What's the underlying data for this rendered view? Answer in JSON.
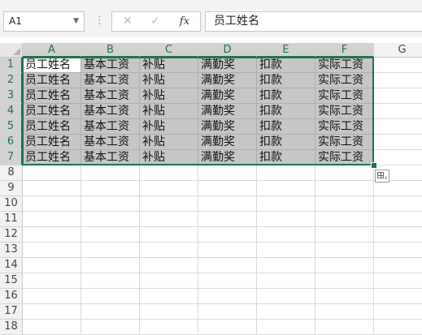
{
  "formula_bar": {
    "name_box": "A1",
    "cancel_icon": "✕",
    "enter_icon": "✓",
    "fx_label": "fx",
    "formula": "员工姓名"
  },
  "sheet": {
    "columns": [
      "A",
      "B",
      "C",
      "D",
      "E",
      "F",
      "G"
    ],
    "rows": [
      "1",
      "2",
      "3",
      "4",
      "5",
      "6",
      "7",
      "8",
      "9",
      "10",
      "11",
      "12",
      "13",
      "14",
      "15",
      "16",
      "17",
      "18"
    ],
    "data": [
      [
        "员工姓名",
        "基本工资",
        "补贴",
        "满勤奖",
        "扣款",
        "实际工资"
      ],
      [
        "员工姓名",
        "基本工资",
        "补贴",
        "满勤奖",
        "扣款",
        "实际工资"
      ],
      [
        "员工姓名",
        "基本工资",
        "补贴",
        "满勤奖",
        "扣款",
        "实际工资"
      ],
      [
        "员工姓名",
        "基本工资",
        "补贴",
        "满勤奖",
        "扣款",
        "实际工资"
      ],
      [
        "员工姓名",
        "基本工资",
        "补贴",
        "满勤奖",
        "扣款",
        "实际工资"
      ],
      [
        "员工姓名",
        "基本工资",
        "补贴",
        "满勤奖",
        "扣款",
        "实际工资"
      ],
      [
        "员工姓名",
        "基本工资",
        "补贴",
        "满勤奖",
        "扣款",
        "实际工资"
      ]
    ],
    "selected_range": "A1:F7",
    "active_cell": "A1"
  },
  "colors": {
    "accent": "#217346",
    "selection_fill": "#c6c6c6"
  }
}
